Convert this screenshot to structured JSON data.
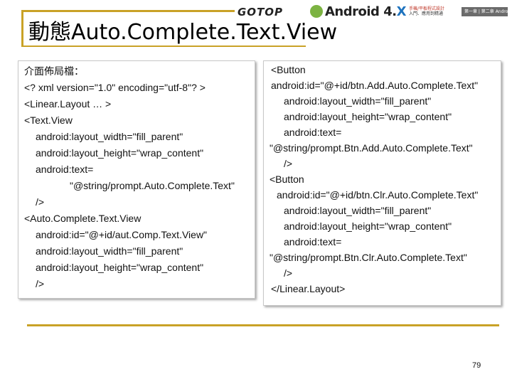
{
  "header": {
    "publisher": "GOTOP",
    "book_logo_main": "Android 4.",
    "book_logo_x": "X",
    "tagline_line1": "手機/平板程式設計",
    "tagline_line2": "入門、應用到精通",
    "strip_text": "第一章 | 第二章 Android 1.x ~ 4.x"
  },
  "title": {
    "cjk": "動態",
    "latin": "Auto.Complete.Text.View"
  },
  "left_box": {
    "lines": [
      "介面佈局檔：",
      "<? xml version=\"1.0\" encoding=\"utf-8\"? >",
      "<Linear.Layout …   >",
      "<Text.View",
      "android:layout_width=\"fill_parent\"",
      "android:layout_height=\"wrap_content\"",
      "android:text=",
      "\"@string/prompt.Auto.Complete.Text\"",
      "/>",
      "<Auto.Complete.Text.View",
      "android:id=\"@+id/aut.Comp.Text.View\"",
      "android:layout_width=\"fill_parent\"",
      "android:layout_height=\"wrap_content\"",
      "/>"
    ]
  },
  "right_box": {
    "lines": [
      "<Button",
      "android:id=\"@+id/btn.Add.Auto.Complete.Text\"",
      "android:layout_width=\"fill_parent\"",
      "android:layout_height=\"wrap_content\"",
      "android:text=",
      "\"@string/prompt.Btn.Add.Auto.Complete.Text\"",
      "/>",
      "<Button",
      "android:id=\"@+id/btn.Clr.Auto.Complete.Text\"",
      "android:layout_width=\"fill_parent\"",
      "android:layout_height=\"wrap_content\"",
      "android:text=",
      "\"@string/prompt.Btn.Clr.Auto.Complete.Text\"",
      "/>",
      "</Linear.Layout>"
    ]
  },
  "footer": {
    "page_number": "79"
  },
  "colors": {
    "accent_rule": "#c9a227"
  }
}
